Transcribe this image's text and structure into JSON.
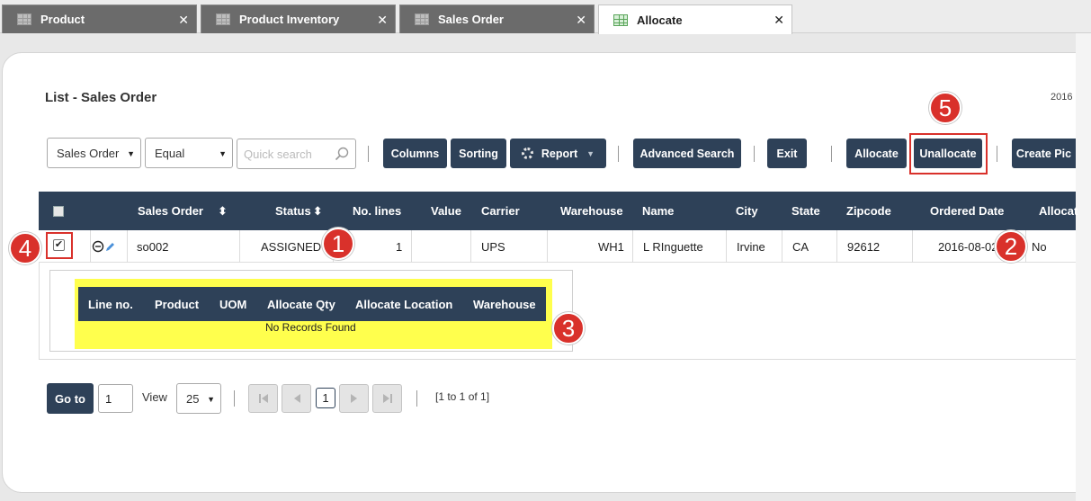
{
  "tabs": [
    {
      "label": "Product",
      "close": "✕"
    },
    {
      "label": "Product Inventory",
      "close": "✕"
    },
    {
      "label": "Sales Order",
      "close": "✕"
    },
    {
      "label": "Allocate",
      "close": "✕"
    }
  ],
  "page": {
    "title": "List - Sales Order",
    "date_fragment": "2016"
  },
  "toolbar": {
    "field_select": "Sales Order",
    "operator_select": "Equal",
    "search_placeholder": "Quick search",
    "columns": "Columns",
    "sorting": "Sorting",
    "report": "Report",
    "advanced_search": "Advanced Search",
    "exit": "Exit",
    "allocate": "Allocate",
    "unallocate": "Unallocate",
    "create_pick": "Create Pic"
  },
  "table": {
    "headers": {
      "sales_order": "Sales Order",
      "status": "Status",
      "no_lines": "No. lines",
      "value": "Value",
      "carrier": "Carrier",
      "warehouse": "Warehouse",
      "name": "Name",
      "city": "City",
      "state": "State",
      "zipcode": "Zipcode",
      "ordered_date": "Ordered Date",
      "allocated": "Allocat"
    },
    "sort_icon": "⬍",
    "row": {
      "checked": "✔",
      "sales_order": "so002",
      "status": "ASSIGNED",
      "no_lines": "1",
      "value": "",
      "carrier": "UPS",
      "warehouse": "WH1",
      "name": "L RInguette",
      "city": "Irvine",
      "state": "CA",
      "zipcode": "92612",
      "ordered_date": "2016-08-02",
      "allocated": "No"
    }
  },
  "subgrid": {
    "headers": {
      "line_no": "Line no.",
      "product": "Product",
      "uom": "UOM",
      "allocate_qty": "Allocate Qty",
      "allocate_location": "Allocate Location",
      "warehouse": "Warehouse"
    },
    "empty": "No Records Found"
  },
  "pager": {
    "goto": "Go to",
    "page_input": "1",
    "view_label": "View",
    "page_size": "25",
    "current_page": "1",
    "info": "[1 to 1 of 1]"
  },
  "annotations": [
    "1",
    "2",
    "3",
    "4",
    "5"
  ],
  "colors": {
    "accent": "#2e4158",
    "highlight": "#ffff4d",
    "annotation": "#d9312b"
  }
}
